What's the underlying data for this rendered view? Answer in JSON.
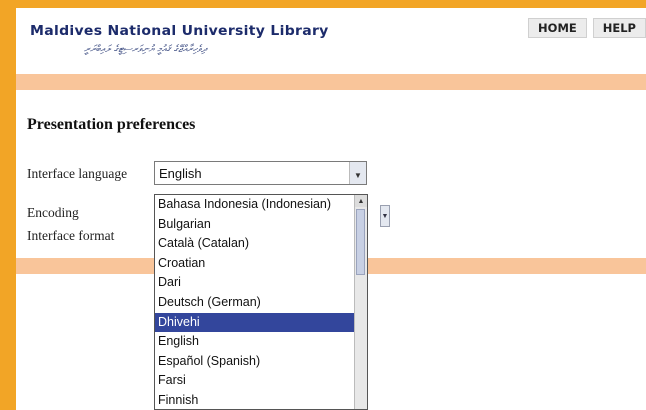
{
  "header": {
    "library_name": "Maldives National University Library",
    "subtitle_dhivehi": "ދިވެހިރާއްޖޭގެ ޤައުމީ ޔުނިވަރސިޓީގެ ލައިބްރަރީ"
  },
  "nav": {
    "home": "HOME",
    "help": "HELP"
  },
  "main": {
    "section_title": "Presentation preferences",
    "fields": {
      "interface_language_label": "Interface language",
      "encoding_label": "Encoding",
      "interface_format_label": "Interface format"
    },
    "language_select": {
      "value": "English"
    },
    "language_options": [
      "Bahasa Indonesia (Indonesian)",
      "Bulgarian",
      "Català (Catalan)",
      "Croatian",
      "Dari",
      "Deutsch (German)",
      "Dhivehi",
      "English",
      "Español (Spanish)",
      "Farsi",
      "Finnish"
    ],
    "highlighted_option": "Dhivehi"
  },
  "icons": {
    "select_arrow": "chevron-down-icon",
    "scroll_up": "chevron-up-icon"
  },
  "colors": {
    "frame": "#f2a526",
    "band": "#f9c59a",
    "highlight": "#33469c",
    "logo_text": "#1c2b6b"
  }
}
